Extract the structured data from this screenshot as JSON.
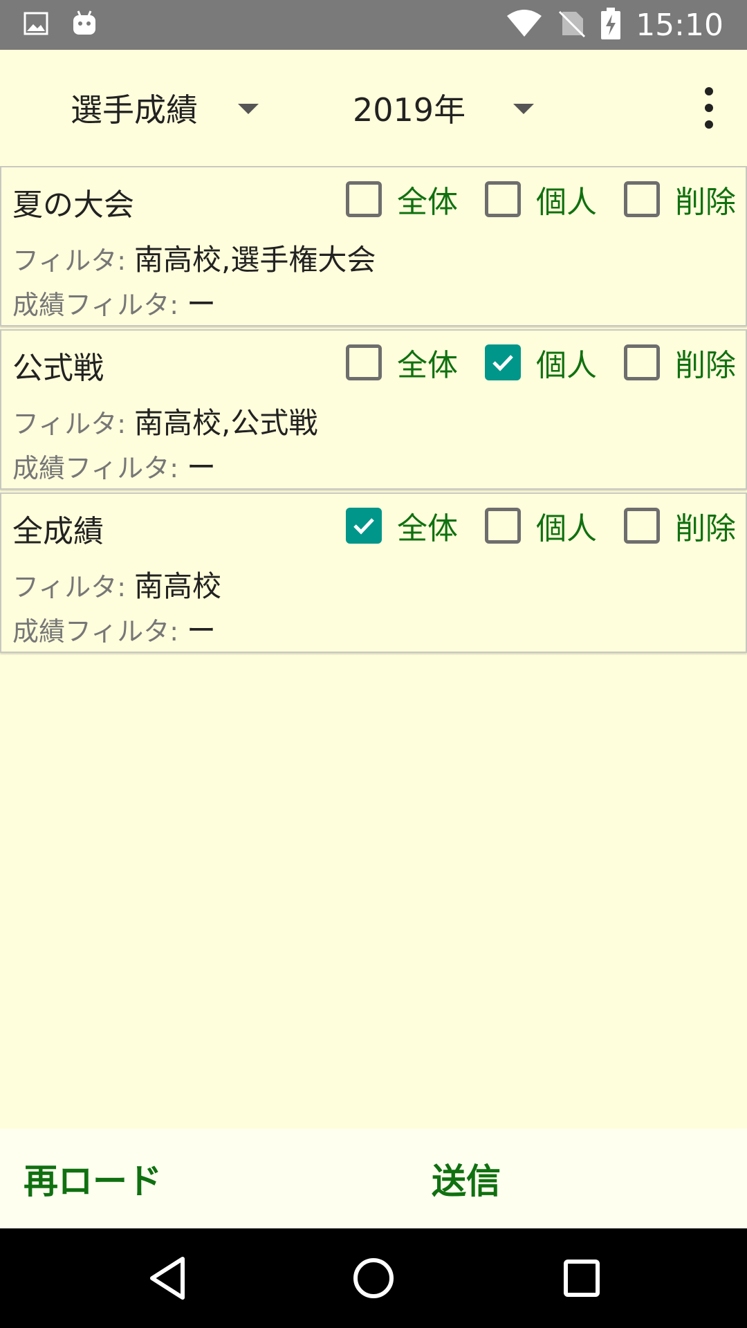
{
  "status_bar": {
    "time": "15:10",
    "icons": [
      "image-icon",
      "android-icon",
      "wifi-icon",
      "no-sim-icon",
      "battery-charging-icon"
    ]
  },
  "toolbar": {
    "category_spinner": "選手成績",
    "year_spinner": "2019年",
    "overflow_icon": "more-vert-icon"
  },
  "cards": [
    {
      "title": "夏の大会",
      "options": [
        {
          "label": "全体",
          "checked": false
        },
        {
          "label": "個人",
          "checked": false
        },
        {
          "label": "削除",
          "checked": false
        }
      ],
      "filter_label": "フィルタ:",
      "filter_value": "南高校,選手権大会",
      "result_filter_label": "成績フィルタ:",
      "result_filter_value": "ー"
    },
    {
      "title": "公式戦",
      "options": [
        {
          "label": "全体",
          "checked": false
        },
        {
          "label": "個人",
          "checked": true
        },
        {
          "label": "削除",
          "checked": false
        }
      ],
      "filter_label": "フィルタ:",
      "filter_value": "南高校,公式戦",
      "result_filter_label": "成績フィルタ:",
      "result_filter_value": "ー"
    },
    {
      "title": "全成績",
      "options": [
        {
          "label": "全体",
          "checked": true
        },
        {
          "label": "個人",
          "checked": false
        },
        {
          "label": "削除",
          "checked": false
        }
      ],
      "filter_label": "フィルタ:",
      "filter_value": "南高校",
      "result_filter_label": "成績フィルタ:",
      "result_filter_value": "ー"
    }
  ],
  "bottom": {
    "reload_label": "再ロード",
    "send_label": "送信"
  },
  "nav_bar": {
    "icons": [
      "back-icon",
      "home-icon",
      "recents-icon"
    ]
  },
  "colors": {
    "background": "#fffedc",
    "accent_green": "#107010",
    "checkbox_checked": "#00968a",
    "status_bar": "#7a7a7a"
  }
}
